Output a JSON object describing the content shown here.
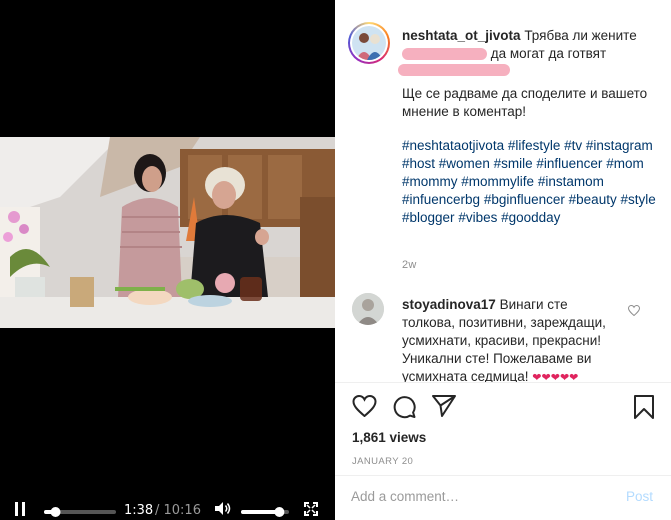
{
  "post": {
    "username": "neshtata_ot_jivota",
    "caption_title_start": "Трябва ли жените",
    "caption_title_end": "да могат да готвят",
    "caption_line2": "Ще се радваме да споделите и вашето мнение в коментар!",
    "hashtags": [
      "#neshtataotjivota",
      "#lifestyle",
      "#tv",
      "#instagram",
      "#host",
      "#women",
      "#smile",
      "#influencer",
      "#mom",
      "#mommy",
      "#mommylife",
      "#instamom",
      "#infuencerbg",
      "#bginfluencer",
      "#beauty",
      "#style",
      "#blogger",
      "#vibes",
      "#goodday"
    ],
    "age": "2w"
  },
  "comment": {
    "username": "stoyadinova17",
    "text": "Винаги сте толкова, позитивни, зареждащи, усмихнати, красиви, прекрасни! Уникални сте! Пожелаваме ви усмихната седмица!",
    "emoji": "❤❤❤❤❤"
  },
  "stats": {
    "views": "1,861 views",
    "date": "JANUARY 20"
  },
  "composer": {
    "placeholder": "Add a comment…",
    "post_label": "Post"
  },
  "player": {
    "current_time": "1:38",
    "duration": "/ 10:16",
    "progress_fraction": 0.16,
    "volume_fraction": 0.8
  },
  "icons": [
    "pause-icon",
    "volume-icon",
    "fullscreen-icon",
    "heart-icon",
    "comment-icon",
    "share-icon",
    "bookmark-icon"
  ],
  "colors": {
    "hashtag": "#00376b",
    "muted": "#8e8e8e",
    "post_disabled": "#b3dbff",
    "redaction": "#f6b0bf"
  }
}
